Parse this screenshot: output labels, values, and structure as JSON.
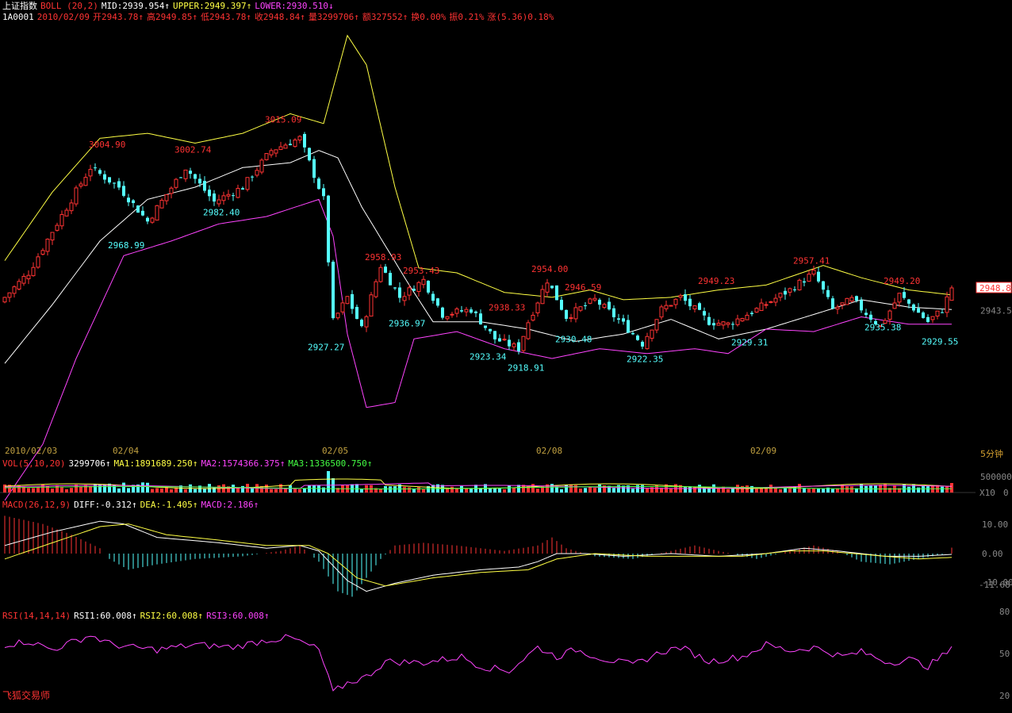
{
  "colors": {
    "bg": "#000000",
    "up": "#ff3333",
    "down": "#55ffff",
    "mid": "#ffffff",
    "upper": "#ffff44",
    "lower": "#ff44ff",
    "axis": "#c0a040",
    "dim": "#888888"
  },
  "header": {
    "index_name": "上证指数",
    "boll_label": "BOLL (20,2)",
    "mid": "MID:2939.954↑",
    "upper": "UPPER:2949.397↑",
    "lower": "LOWER:2930.510↓",
    "code": "1A0001",
    "date": "2010/02/09",
    "open": "开2943.78↑",
    "high": "高2949.85↑",
    "low": "低2943.78↑",
    "close": "收2948.84↑",
    "vol": "量3299706↑",
    "amount": "额327552↑",
    "turnover": "换0.00%",
    "amplitude": "振0.21%",
    "change": "涨(5.36)0.18%"
  },
  "vol_header": {
    "label": "VOL(5,10,20)",
    "value": "3299706↑",
    "ma1": "MA1:1891689.250↑",
    "ma2": "MA2:1574366.375↑",
    "ma3": "MA3:1336500.750↑"
  },
  "macd_header": {
    "label": "MACD(26,12,9)",
    "diff": "DIFF:-0.312↑",
    "dea": "DEA:-1.405↑",
    "macd": "MACD:2.186↑"
  },
  "rsi_header": {
    "label": "RSI(14,14,14)",
    "rsi1": "RSI1:60.008↑",
    "rsi2": "RSI2:60.008↑",
    "rsi3": "RSI3:60.008↑"
  },
  "brand": "飞狐交易师",
  "period": "5分钟",
  "chart_data": {
    "type": "candlestick",
    "dates": [
      "2010/02/03",
      "02/04",
      "02/05",
      "02/08",
      "02/09"
    ],
    "price_tags": {
      "last": "2948.8",
      "mid": "2943.5"
    },
    "axis_labels": {
      "vol": [
        "500000",
        "X10",
        "0"
      ],
      "macd": [
        "10.00",
        "0.00",
        "-10.00",
        "-11.68"
      ],
      "rsi": [
        "80",
        "50",
        "20"
      ]
    },
    "high_annotations": [
      {
        "label": "3004.90",
        "value": 3004.9
      },
      {
        "label": "3002.74",
        "value": 3002.74
      },
      {
        "label": "3015.09",
        "value": 3015.09
      },
      {
        "label": "2958.93",
        "value": 2958.93
      },
      {
        "label": "2953.43",
        "value": 2953.43
      },
      {
        "label": "2938.33",
        "value": 2938.33
      },
      {
        "label": "2954.00",
        "value": 2954.0
      },
      {
        "label": "2946.59",
        "value": 2946.59
      },
      {
        "label": "2949.23",
        "value": 2949.23
      },
      {
        "label": "2957.41",
        "value": 2957.41
      },
      {
        "label": "2949.20",
        "value": 2949.2
      }
    ],
    "low_annotations": [
      {
        "label": "2968.99",
        "value": 2968.99
      },
      {
        "label": "2982.40",
        "value": 2982.4
      },
      {
        "label": "2927.27",
        "value": 2927.27
      },
      {
        "label": "2936.97",
        "value": 2936.97
      },
      {
        "label": "2923.34",
        "value": 2923.34
      },
      {
        "label": "2918.91",
        "value": 2918.91
      },
      {
        "label": "2930.48",
        "value": 2930.48
      },
      {
        "label": "2922.35",
        "value": 2922.35
      },
      {
        "label": "2929.31",
        "value": 2929.31
      },
      {
        "label": "2935.38",
        "value": 2935.38
      },
      {
        "label": "2929.55",
        "value": 2929.55
      }
    ]
  }
}
